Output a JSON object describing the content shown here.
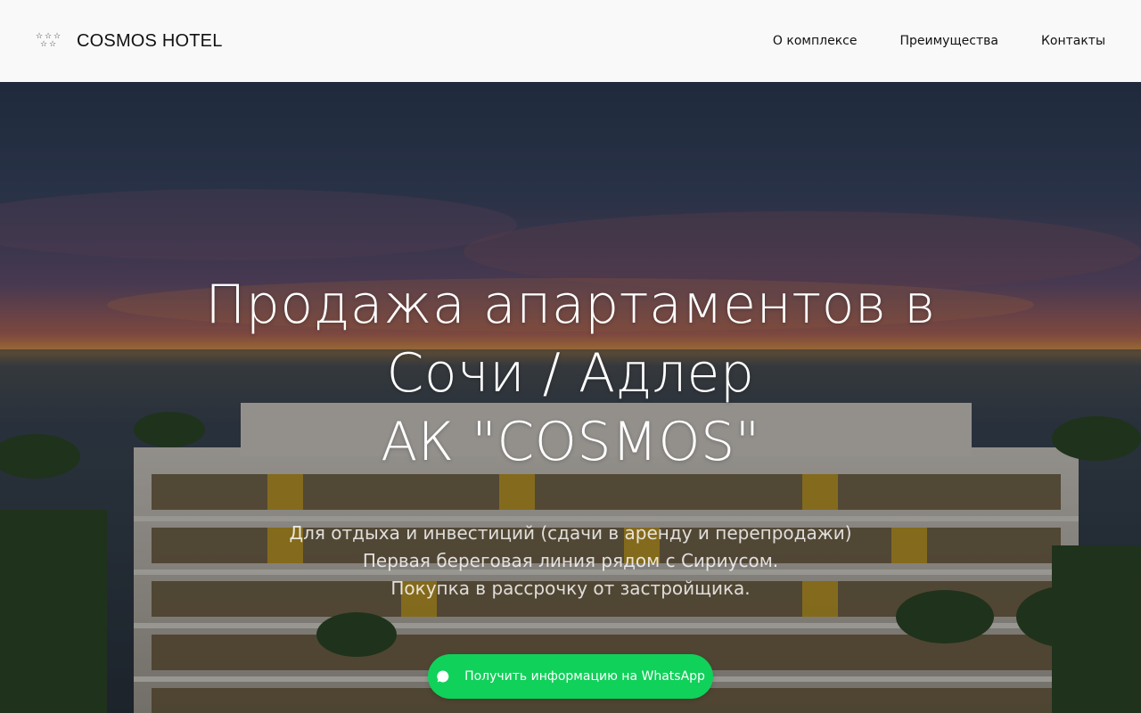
{
  "header": {
    "logo_text": "COSMOS HOTEL",
    "nav": [
      {
        "label": "О комплексе"
      },
      {
        "label": "Преимущества"
      },
      {
        "label": "Контакты"
      }
    ]
  },
  "hero": {
    "title_lines": [
      "Продажа апартаментов в",
      "Сочи / Адлер",
      "АК \"COSMOS\""
    ],
    "subtitle_lines": [
      "Для отдыха и инвестиций (сдачи в аренду и перепродажи)",
      "Первая береговая линия рядом с Сириусом.",
      "Покупка в рассрочку от застройщика."
    ],
    "button_label": "Получить информацию на WhatsApp"
  },
  "colors": {
    "header_bg": "#f9f9f9",
    "button_bg": "#10d15a",
    "text_light": "#ffffff"
  },
  "icons": {
    "logo": "stars-icon",
    "button": "whatsapp-chat-icon"
  }
}
